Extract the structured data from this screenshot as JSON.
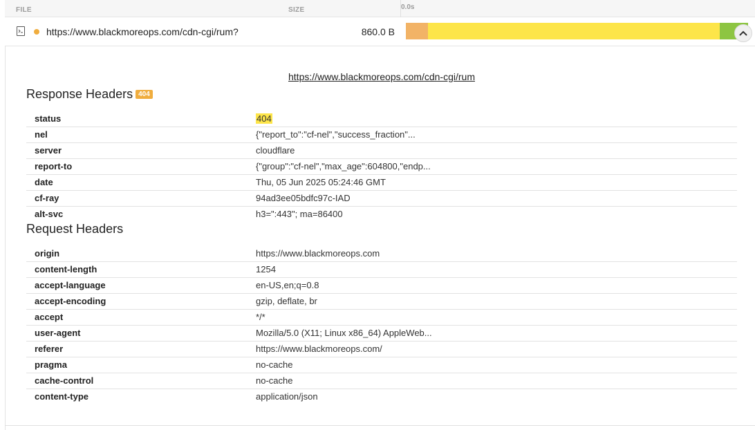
{
  "columns": {
    "file": "FILE",
    "size": "SIZE",
    "timeline_start": "0.0s"
  },
  "entry": {
    "url": "https://www.blackmoreops.com/cdn-cgi/rum?",
    "size": "860.0 B",
    "status_color": "#f0ad3e",
    "timing": {
      "wait_fraction": 0.064,
      "download_fraction": 0.853,
      "end_fraction": 0.083
    },
    "timing_colors": {
      "wait": "#f2b366",
      "download": "#fde549",
      "end": "#8dc542"
    }
  },
  "detail": {
    "request_url": "https://www.blackmoreops.com/cdn-cgi/rum",
    "response_title": "Response Headers",
    "response_code": "404",
    "response_headers": [
      {
        "name": "status",
        "value": "404"
      },
      {
        "name": "nel",
        "value": "{\"report_to\":\"cf-nel\",\"success_fraction\"..."
      },
      {
        "name": "server",
        "value": "cloudflare"
      },
      {
        "name": "report-to",
        "value": "{\"group\":\"cf-nel\",\"max_age\":604800,\"endp..."
      },
      {
        "name": "date",
        "value": "Thu, 05 Jun 2025 05:24:46 GMT"
      },
      {
        "name": "cf-ray",
        "value": "94ad3ee05bdfc97c-IAD"
      },
      {
        "name": "alt-svc",
        "value": "h3=\":443\"; ma=86400"
      }
    ],
    "request_title": "Request Headers",
    "request_headers": [
      {
        "name": "origin",
        "value": "https://www.blackmoreops.com"
      },
      {
        "name": "content-length",
        "value": "1254"
      },
      {
        "name": "accept-language",
        "value": "en-US,en;q=0.8"
      },
      {
        "name": "accept-encoding",
        "value": "gzip, deflate, br"
      },
      {
        "name": "accept",
        "value": "*/*"
      },
      {
        "name": "user-agent",
        "value": "Mozilla/5.0 (X11; Linux x86_64) AppleWeb..."
      },
      {
        "name": "referer",
        "value": "https://www.blackmoreops.com/"
      },
      {
        "name": "pragma",
        "value": "no-cache"
      },
      {
        "name": "cache-control",
        "value": "no-cache"
      },
      {
        "name": "content-type",
        "value": "application/json"
      }
    ]
  },
  "icons": {
    "file_type": "file-code-icon",
    "collapse": "chevron-up-icon"
  }
}
